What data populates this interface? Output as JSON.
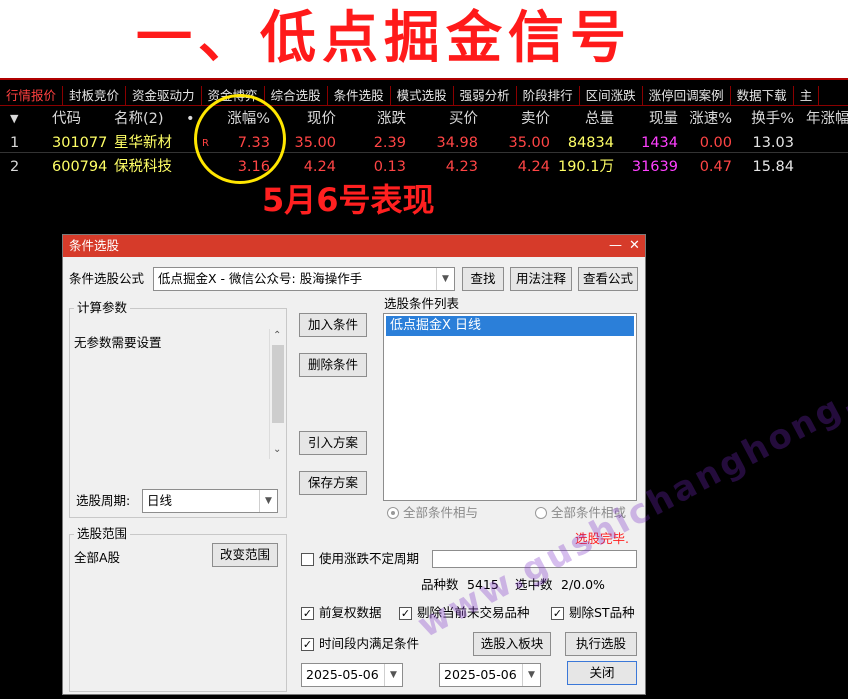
{
  "headline": "一、低点掘金信号",
  "tabs": [
    "行情报价",
    "封板竞价",
    "资金驱动力",
    "资金博弈",
    "综合选股",
    "条件选股",
    "模式选股",
    "强弱分析",
    "阶段排行",
    "区间涨跌",
    "涨停回调案例",
    "数据下载",
    "主"
  ],
  "columns": {
    "sort": "▼",
    "code": "代码",
    "name": "名称(2)",
    "dot": "•",
    "chg": "涨幅%",
    "price": "现价",
    "updown": "涨跌",
    "bid": "买价",
    "ask": "卖价",
    "vol": "总量",
    "cur": "现量",
    "speed": "涨速%",
    "turn": "换手%",
    "year": "年涨幅"
  },
  "rows": [
    {
      "idx": "1",
      "code": "301077",
      "name": "星华新材",
      "flag": "R",
      "chg": "7.33",
      "price": "35.00",
      "updown": "2.39",
      "bid": "34.98",
      "ask": "35.00",
      "vol": "84834",
      "cur": "1434",
      "speed": "0.00",
      "turn": "13.03"
    },
    {
      "idx": "2",
      "code": "600794",
      "name": "保税科技",
      "flag": "",
      "chg": "3.16",
      "price": "4.24",
      "updown": "0.13",
      "bid": "4.23",
      "ask": "4.24",
      "vol": "190.1万",
      "cur": "31639",
      "speed": "0.47",
      "turn": "15.84"
    }
  ],
  "annotation": "5月6号表现",
  "dialog": {
    "title": "条件选股",
    "minimize": "—",
    "close": "✕",
    "formula_label": "条件选股公式",
    "formula_value": "低点掘金X  -  微信公众号: 股海操作手",
    "find": "查找",
    "usage": "用法注释",
    "view_formula": "查看公式",
    "calc_params_title": "计算参数",
    "calc_params_text": "无参数需要设置",
    "add_condition": "加入条件",
    "delete_condition": "删除条件",
    "import_scheme": "引入方案",
    "save_scheme": "保存方案",
    "cond_list_title": "选股条件列表",
    "cond_items": [
      "低点掘金X  日线"
    ],
    "period_label": "选股周期:",
    "period_value": "日线",
    "radio_and": "全部条件相与",
    "radio_or": "全部条件相或",
    "status": "选股完毕.",
    "scope_title": "选股范围",
    "scope_value": "全部A股",
    "change_scope": "改变范围",
    "use_irregular": "使用涨跌不定周期",
    "count_label": "品种数",
    "count_value": "5415",
    "selected_label": "选中数",
    "selected_value": "2/0.0%",
    "opt_fq": "前复权数据",
    "opt_untraded": "剔除当前未交易品种",
    "opt_st": "剔除ST品种",
    "opt_period": "时间段内满足条件",
    "to_block": "选股入板块",
    "run": "执行选股",
    "date_from": "2025-05-06",
    "date_to": "2025-05-06",
    "close_btn": "关闭",
    "check": "✓"
  },
  "watermark": "www.gushichanghong.com",
  "colors": {
    "headline": "#ff1a1a",
    "terminal_bg": "#000000",
    "up_red": "#ff4545",
    "name_yellow": "#ffff66",
    "cur_magenta": "#ff40ff",
    "circle": "#ffe600",
    "dialog_title": "#d63b2a",
    "selection": "#2b7fd9"
  }
}
